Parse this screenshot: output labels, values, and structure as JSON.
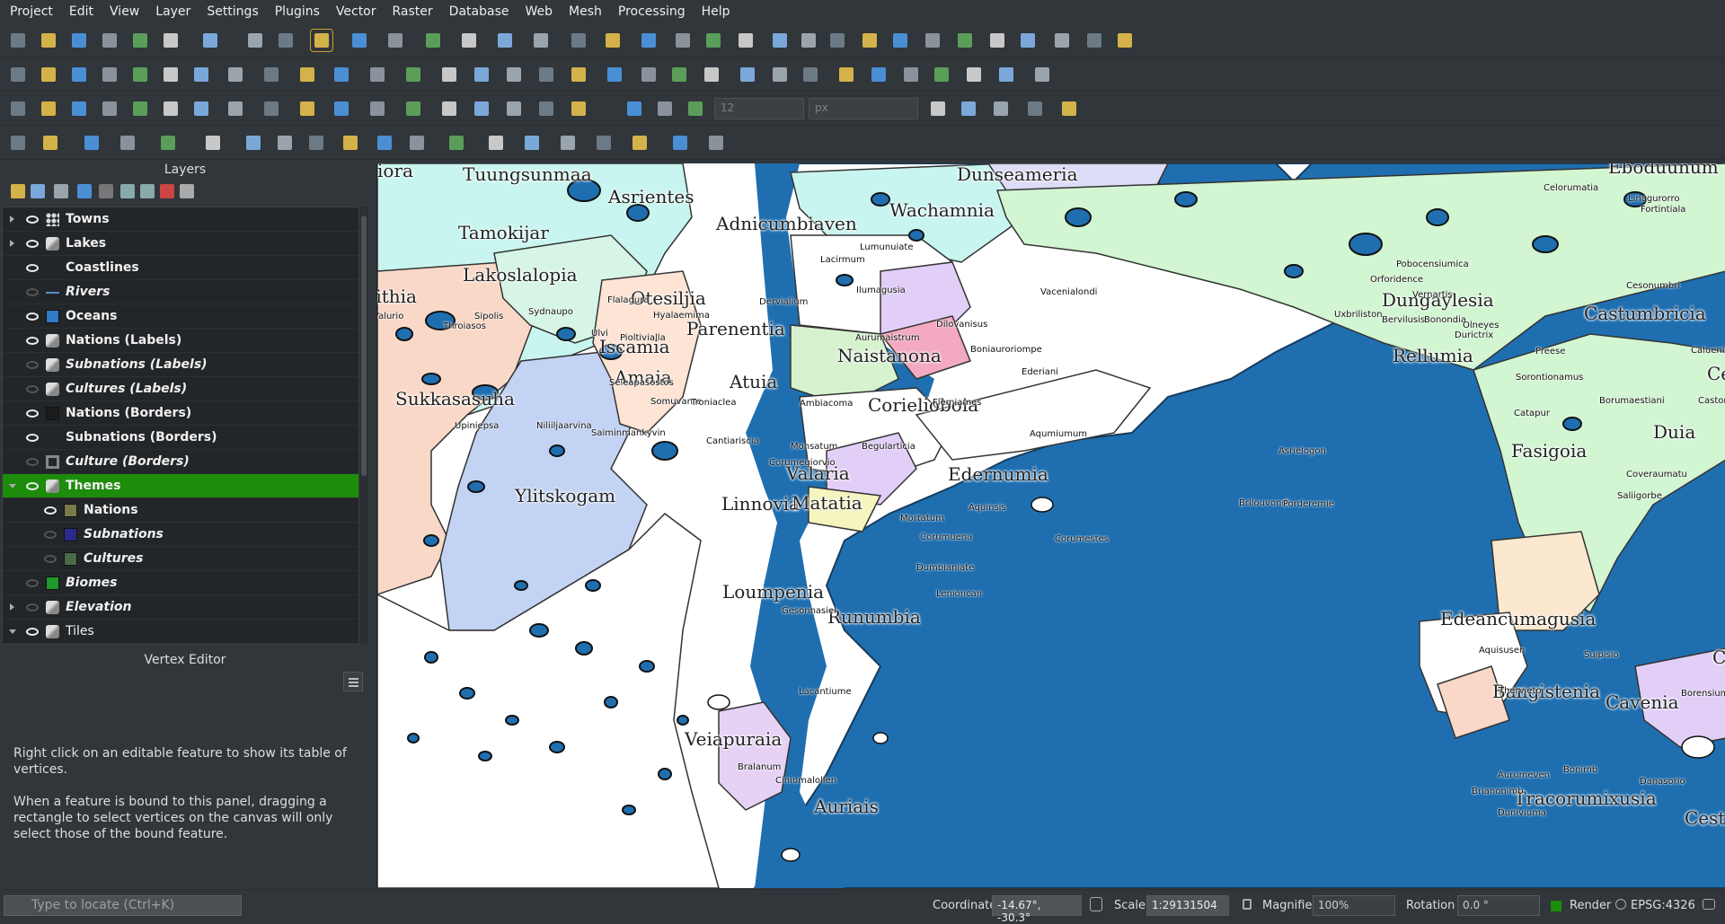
{
  "menu": [
    "Project",
    "Edit",
    "View",
    "Layer",
    "Settings",
    "Plugins",
    "Vector",
    "Raster",
    "Database",
    "Web",
    "Mesh",
    "Processing",
    "Help"
  ],
  "toolbar": {
    "snap_tolerance": "12",
    "snap_units": "px"
  },
  "layers_panel": {
    "title": "Layers",
    "items": [
      {
        "label": "Towns",
        "visible": true,
        "italic": false,
        "expand": "collapsed",
        "indent": 0,
        "symbol": "points"
      },
      {
        "label": "Lakes",
        "visible": true,
        "italic": false,
        "expand": "collapsed",
        "indent": 0,
        "symbol": "categorized"
      },
      {
        "label": "Coastlines",
        "visible": true,
        "italic": false,
        "expand": "none",
        "indent": 0,
        "symbol": "none"
      },
      {
        "label": "Rivers",
        "visible": false,
        "italic": true,
        "expand": "none",
        "indent": 0,
        "symbol": "line"
      },
      {
        "label": "Oceans",
        "visible": true,
        "italic": false,
        "expand": "none",
        "indent": 0,
        "symbol": "#2f7ac4"
      },
      {
        "label": "Nations (Labels)",
        "visible": true,
        "italic": false,
        "expand": "none",
        "indent": 0,
        "symbol": "categorized"
      },
      {
        "label": "Subnations (Labels)",
        "visible": false,
        "italic": true,
        "expand": "none",
        "indent": 0,
        "symbol": "categorized"
      },
      {
        "label": "Cultures (Labels)",
        "visible": false,
        "italic": true,
        "expand": "none",
        "indent": 0,
        "symbol": "categorized"
      },
      {
        "label": "Nations (Borders)",
        "visible": true,
        "italic": false,
        "expand": "none",
        "indent": 0,
        "symbol": "#1b1b1b"
      },
      {
        "label": "Subnations (Borders)",
        "visible": true,
        "italic": false,
        "expand": "none",
        "indent": 0,
        "symbol": "none"
      },
      {
        "label": "Culture (Borders)",
        "visible": false,
        "italic": true,
        "expand": "none",
        "indent": 0,
        "symbol": "outline"
      },
      {
        "label": "Themes",
        "visible": true,
        "italic": false,
        "expand": "expanded",
        "indent": 0,
        "symbol": "group",
        "selected": true
      },
      {
        "label": "Nations",
        "visible": true,
        "italic": false,
        "expand": "none",
        "indent": 1,
        "symbol": "#7a7a4a"
      },
      {
        "label": "Subnations",
        "visible": false,
        "italic": true,
        "expand": "none",
        "indent": 1,
        "symbol": "#2a2a8a"
      },
      {
        "label": "Cultures",
        "visible": false,
        "italic": true,
        "expand": "none",
        "indent": 1,
        "symbol": "#4a6a4a"
      },
      {
        "label": "Biomes",
        "visible": false,
        "italic": true,
        "expand": "none",
        "indent": 0,
        "symbol": "#1e9a2a"
      },
      {
        "label": "Elevation",
        "visible": false,
        "italic": true,
        "expand": "collapsed",
        "indent": 0,
        "symbol": "categorized"
      },
      {
        "label": "Tiles",
        "visible": true,
        "italic": false,
        "expand": "expanded",
        "indent": 0,
        "symbol": "raster",
        "plain": true
      }
    ]
  },
  "vertex_editor": {
    "title": "Vertex Editor",
    "text1": "Right click on an editable feature to show its table of vertices.",
    "text2": "When a feature is bound to this panel, dragging a rectangle to select vertices on the canvas will only select those of the bound feature."
  },
  "map": {
    "nation_labels": [
      {
        "t": "Tuungsunmaa"
      },
      {
        "t": "Asrientes"
      },
      {
        "t": "Dunseameria"
      },
      {
        "t": "Eboduunum"
      },
      {
        "t": "Tamokijar"
      },
      {
        "t": "Adnicumbiaven"
      },
      {
        "t": "Wachamnia"
      },
      {
        "t": "Lakoslalopia"
      },
      {
        "t": "Tithia"
      },
      {
        "t": "Otesiljia"
      },
      {
        "t": "Parenentia"
      },
      {
        "t": "Dungaylesia"
      },
      {
        "t": "Castumbricia"
      },
      {
        "t": "Iscamia"
      },
      {
        "t": "Rellumia"
      },
      {
        "t": "Naistanona"
      },
      {
        "t": "Sukkasasuha"
      },
      {
        "t": "Amaia"
      },
      {
        "t": "Atuia"
      },
      {
        "t": "Corielioboia"
      },
      {
        "t": "Duia"
      },
      {
        "t": "Fasigoia"
      },
      {
        "t": "Valaria"
      },
      {
        "t": "Edernumia"
      },
      {
        "t": "Ylitskogam"
      },
      {
        "t": "Linnovia"
      },
      {
        "t": "Matatia"
      },
      {
        "t": "Loumpenia"
      },
      {
        "t": "Runumbia"
      },
      {
        "t": "Edeancumagusia"
      },
      {
        "t": "Bangistenia"
      },
      {
        "t": "Cavenia"
      },
      {
        "t": "Veiapuraia"
      },
      {
        "t": "Auriais"
      },
      {
        "t": "Tracorumixusia"
      },
      {
        "t": "Cestue"
      },
      {
        "t": "iora"
      },
      {
        "t": "Ce"
      },
      {
        "t": "C"
      }
    ],
    "towns": [
      "Lacirmum",
      "Lumunuiate",
      "Celorumatia",
      "Linagurorro",
      "Fortintiala",
      "Pobocensiumica",
      "Vacenialondi",
      "Ilumagusia",
      "Orforidence",
      "Vernartis",
      "Cesonumbri",
      "Flalagura",
      "Sipolis",
      "Sydnaupo",
      "Hyalaemima",
      "Dervialium",
      "Valurio",
      "Bervilusis",
      "Uxbriliston",
      "Bonondia",
      "Olneyes",
      "Caluenium",
      "Throiasos",
      "Ulvi",
      "Pioltivialla",
      "Dilovanisus",
      "Aurumaistrum",
      "Durictrix",
      "Preese",
      "Boniauroriompe",
      "Ederiani",
      "Seleapasostos",
      "Sorontionamus",
      "Borumaestiani",
      "Castorumbi",
      "Somuvanre",
      "Troniaclea",
      "Ambiacoma",
      "Flemiames",
      "Catapur",
      "Upiniepsa",
      "Niliiljaarvina",
      "Saiminmankyvin",
      "Aqumiumum",
      "Cantiariscia",
      "Monsatum",
      "Begularticia",
      "Asrielogon",
      "Corumegiorvio",
      "Coveraumatu",
      "Saliigorbe",
      "Brilouvondi",
      "Aquinsis",
      "Porderemie",
      "Mortatum",
      "Corumuena",
      "Corumestes",
      "Dumbianiate",
      "Lenioncan",
      "Gesonnasiel",
      "Suipisio",
      "Aquisusen",
      "Thervieto",
      "Borensiumu",
      "Lacantiume",
      "Aurumeven",
      "Bonimb",
      "Danasorio",
      "Brianonimb",
      "Duniviuma",
      "Bralanum",
      "Ciniumalollen"
    ]
  },
  "statusbar": {
    "locate_placeholder": "Type to locate (Ctrl+K)",
    "coordinate_label": "Coordinate",
    "coordinate_value": "-14.67°, -30.3°",
    "scale_label": "Scale",
    "scale_value": "1:29131504",
    "magnifier_label": "Magnifier",
    "magnifier_value": "100%",
    "rotation_label": "Rotation",
    "rotation_value": "0.0 °",
    "render_label": "Render",
    "crs": "EPSG:4326"
  }
}
